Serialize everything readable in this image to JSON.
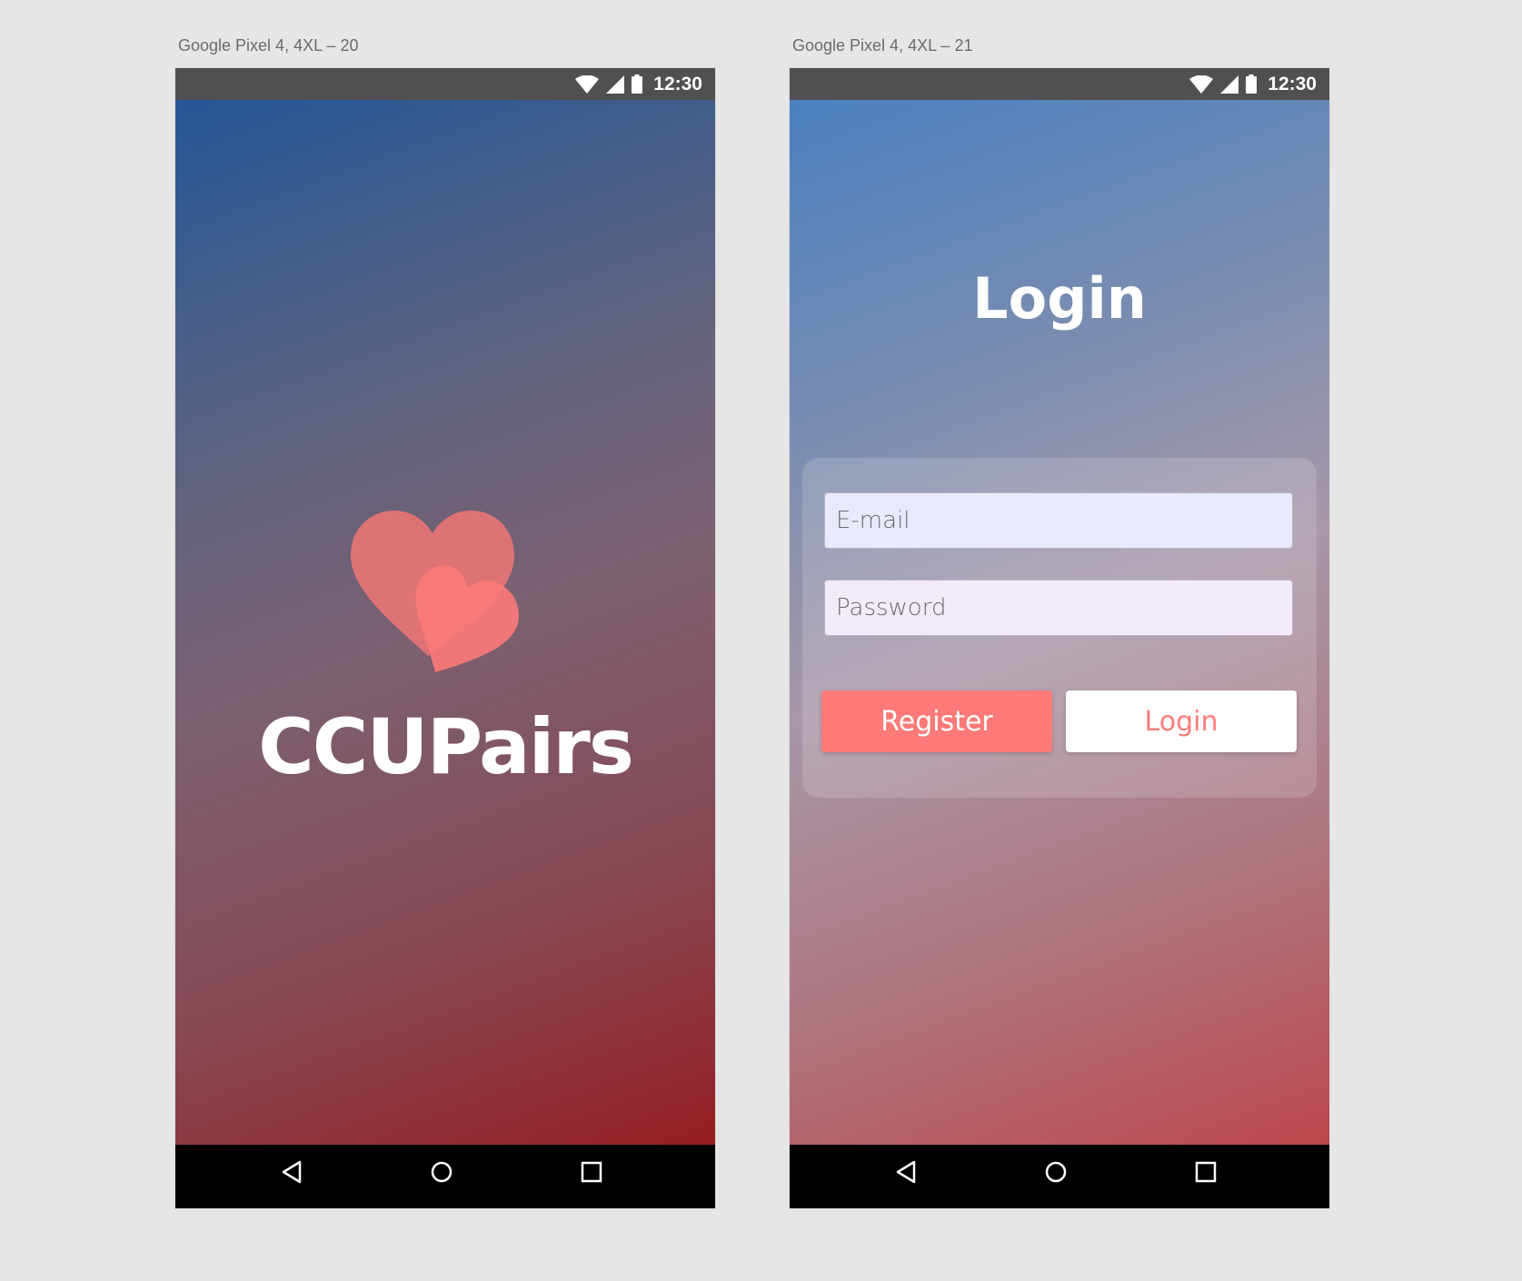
{
  "artboards": [
    {
      "label": "Google Pixel 4, 4XL – 20",
      "status_time": "12:30",
      "brand_name": "CCUPairs"
    },
    {
      "label": "Google Pixel 4, 4XL – 21",
      "status_time": "12:30",
      "title": "Login",
      "email_placeholder": "E-mail",
      "password_placeholder": "Password",
      "register_label": "Register",
      "login_label": "Login"
    }
  ],
  "icons": {
    "status": [
      "wifi-icon",
      "cell-signal-icon",
      "battery-icon"
    ],
    "nav": [
      "back-icon",
      "home-icon",
      "recents-icon"
    ],
    "logo": "hearts-logo-icon"
  },
  "colors": {
    "artboard_background": "#e6e6e6",
    "status_bar": "#505050",
    "nav_bar": "#000000",
    "splash_gradient": [
      "#245696",
      "#951e24"
    ],
    "login_gradient": [
      "#4b80c0",
      "#bd484f"
    ],
    "heart_large": "#e47475",
    "heart_small": "#fa7a79",
    "register_button": "#fe7a78",
    "login_button_text": "#fc7d7a"
  }
}
